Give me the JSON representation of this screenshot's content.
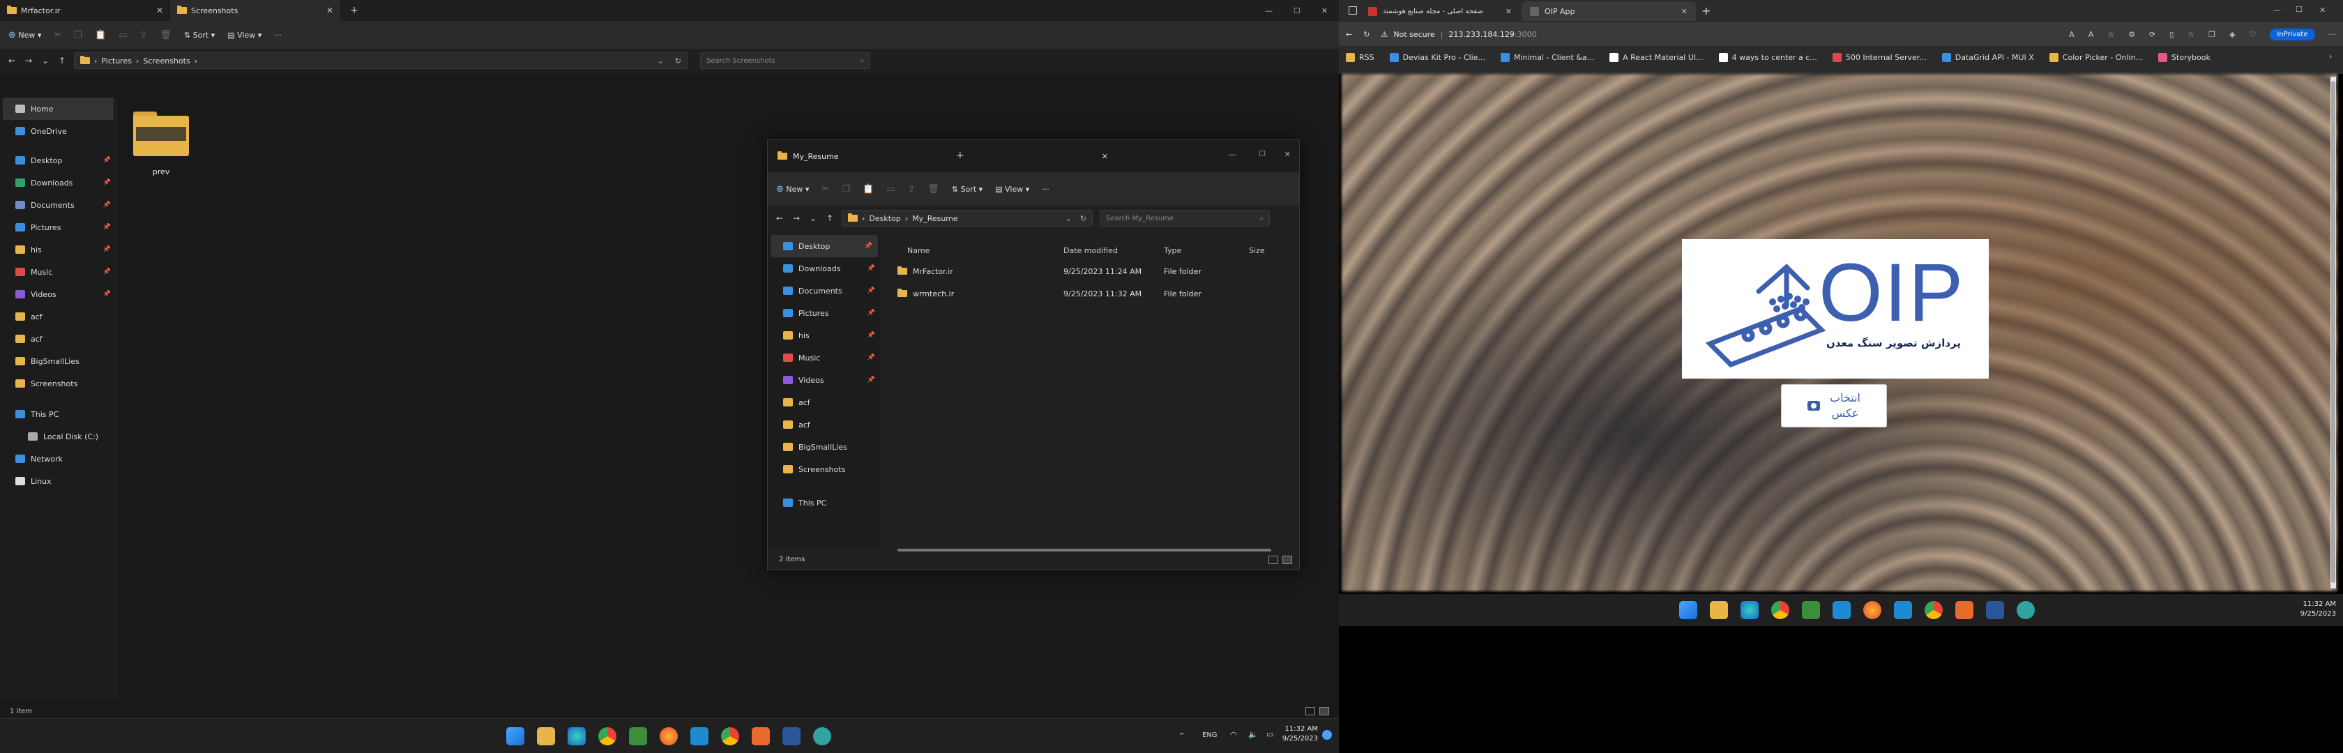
{
  "explorer_main": {
    "tabs": [
      {
        "label": "Mrfactor.ir",
        "active": false
      },
      {
        "label": "Screenshots",
        "active": true
      }
    ],
    "toolbar": {
      "new_label": "New",
      "sort_label": "Sort",
      "view_label": "View"
    },
    "breadcrumb": [
      "Pictures",
      "Screenshots"
    ],
    "search_placeholder": "Search Screenshots",
    "nav_items": [
      {
        "label": "Home",
        "icon": "home-icon",
        "pinned": false,
        "selected": true
      },
      {
        "label": "OneDrive",
        "icon": "cloud-icon",
        "pinned": false
      },
      {
        "label": "Desktop",
        "icon": "desktop-icon",
        "pinned": true
      },
      {
        "label": "Downloads",
        "icon": "download-icon",
        "pinned": true
      },
      {
        "label": "Documents",
        "icon": "documents-icon",
        "pinned": true
      },
      {
        "label": "Pictures",
        "icon": "pictures-icon",
        "pinned": true
      },
      {
        "label": "his",
        "icon": "folder-icon",
        "pinned": true
      },
      {
        "label": "Music",
        "icon": "music-icon",
        "pinned": true
      },
      {
        "label": "Videos",
        "icon": "videos-icon",
        "pinned": true
      },
      {
        "label": "acf",
        "icon": "folder-icon"
      },
      {
        "label": "acf",
        "icon": "folder-icon"
      },
      {
        "label": "BigSmallLies",
        "icon": "folder-icon"
      },
      {
        "label": "Screenshots",
        "icon": "folder-icon"
      },
      {
        "label": "This PC",
        "icon": "pc-icon"
      },
      {
        "label": "Local Disk (C:)",
        "icon": "disk-icon"
      },
      {
        "label": "Network",
        "icon": "network-icon"
      },
      {
        "label": "Linux",
        "icon": "linux-icon"
      }
    ],
    "folder_item": "prev",
    "status": "1 item"
  },
  "explorer_window": {
    "title": "My_Resume",
    "toolbar": {
      "new_label": "New",
      "sort_label": "Sort",
      "view_label": "View"
    },
    "breadcrumb": [
      "Desktop",
      "My_Resume"
    ],
    "search_placeholder": "Search My_Resume",
    "nav_items": [
      "Desktop",
      "Downloads",
      "Documents",
      "Pictures",
      "his",
      "Music",
      "Videos",
      "acf",
      "acf",
      "BigSmallLies",
      "Screenshots",
      "This PC"
    ],
    "columns": [
      "Name",
      "Date modified",
      "Type",
      "Size"
    ],
    "rows": [
      {
        "name": "MrFactor.ir",
        "date": "9/25/2023 11:24 AM",
        "type": "File folder"
      },
      {
        "name": "wrmtech.ir",
        "date": "9/25/2023 11:32 AM",
        "type": "File folder"
      }
    ],
    "status": "2 items"
  },
  "taskbar_left": {
    "lang": "ENG",
    "time": "11:32 AM",
    "date": "9/25/2023"
  },
  "browser": {
    "tabs": [
      {
        "label": "صفحه اصلی - مجله صنایع هوشمند"
      },
      {
        "label": "OIP App",
        "active": true
      }
    ],
    "security_label": "Not secure",
    "url": "213.233.184.129",
    "url_port": ":3000",
    "inprivate_label": "InPrivate",
    "bookmarks": [
      "RSS",
      "Devias Kit Pro - Clie...",
      "Minimal - Client &a...",
      "A React Material UI...",
      "4 ways to center a c...",
      "500 Internal Server...",
      "DataGrid API - MUI X",
      "Color Picker - Onlin...",
      "Storybook"
    ],
    "page": {
      "logo_text": "OIP",
      "logo_subtitle": "پردازش تصویر سنگ معدن",
      "upload_label_line1": "انتخاب",
      "upload_label_line2": "عکس"
    }
  },
  "taskbar_right": {
    "time": "11:32 AM",
    "date": "9/25/2023"
  },
  "colors": {
    "folder": "#e8b54a",
    "accent": "#0a64d8",
    "logo_blue": "#3c5fb0"
  }
}
